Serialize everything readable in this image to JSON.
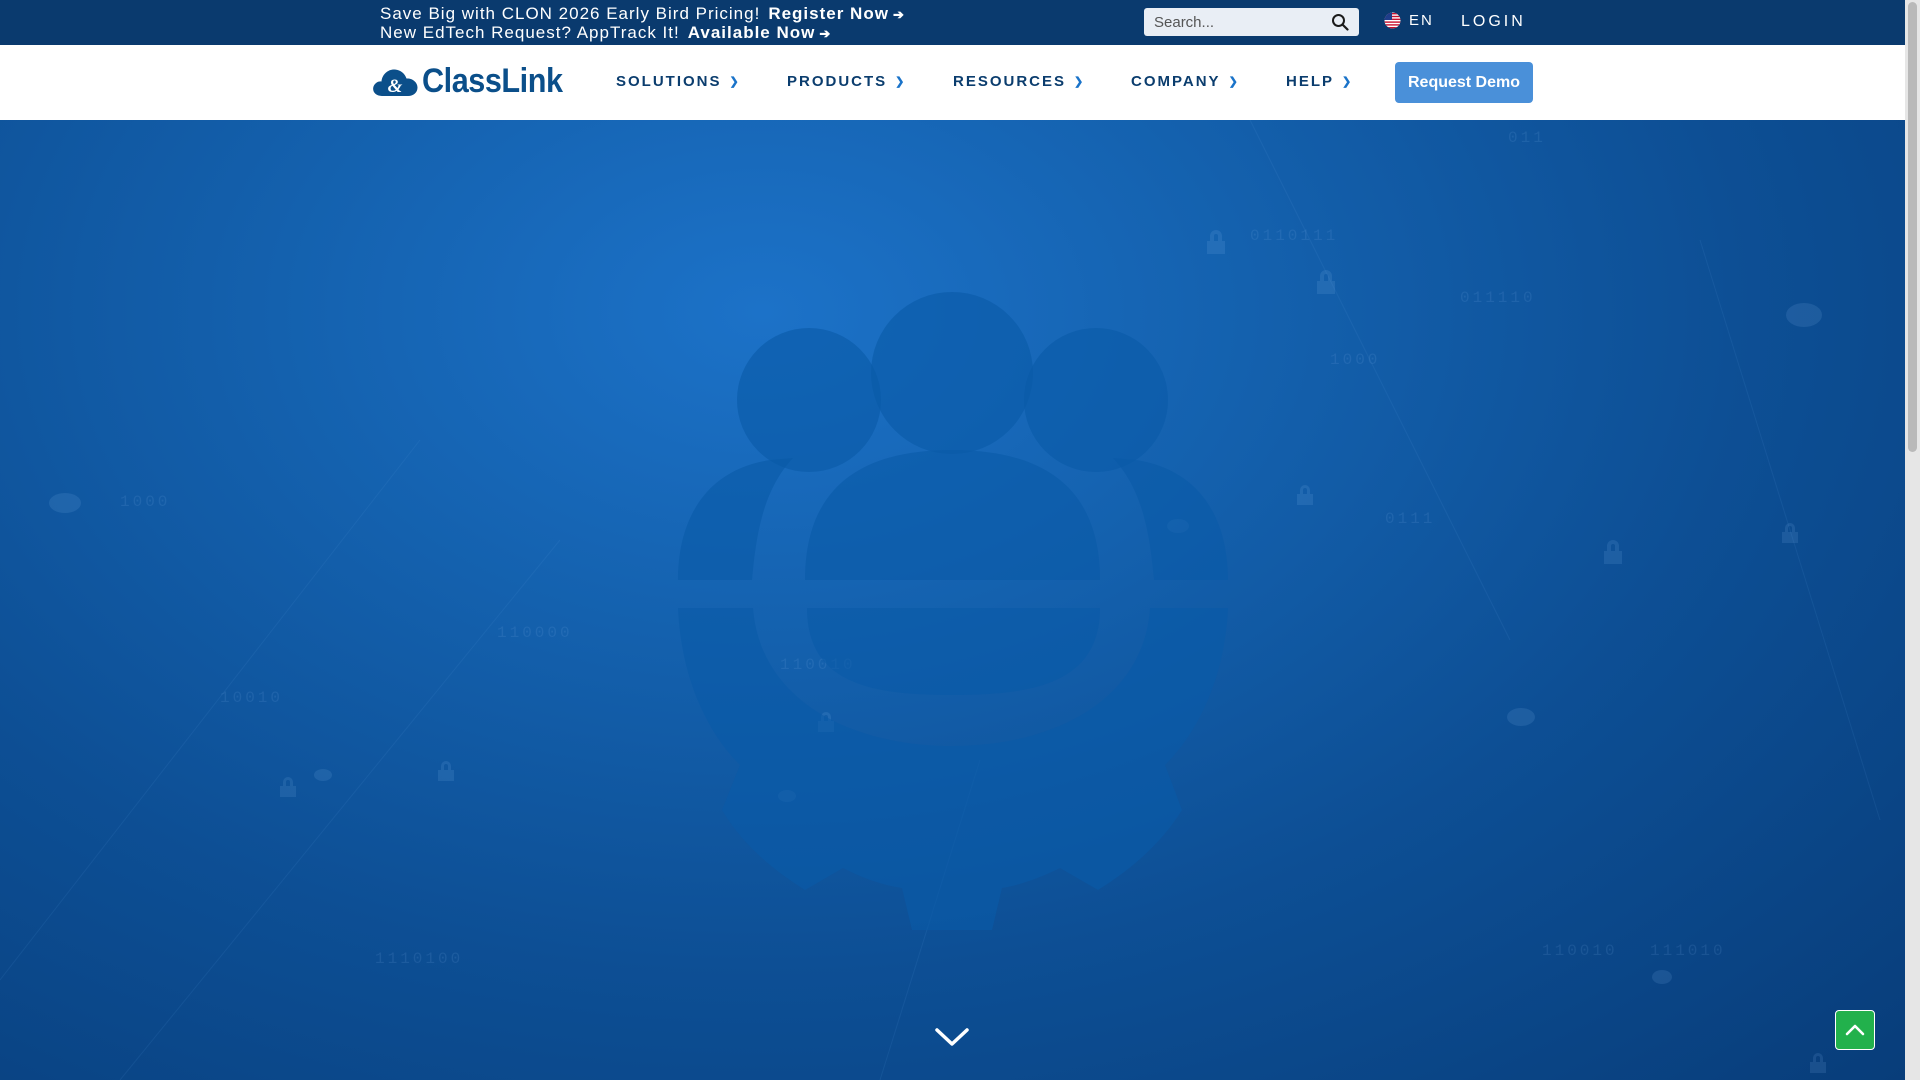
{
  "topbar": {
    "promo_text": "Save Big with CLON 2026 Early Bird Pricing!",
    "promo_link": "Register Now",
    "apptrack_text": "New EdTech Request? AppTrack It!",
    "apptrack_link": "Available Now",
    "search_placeholder": "Search...",
    "language": "EN",
    "login": "LOGIN"
  },
  "nav": {
    "logo": "ClassLink",
    "menu": [
      "SOLUTIONS",
      "PRODUCTS",
      "RESOURCES",
      "COMPANY",
      "HELP"
    ],
    "cta": "Request Demo"
  },
  "hero": {
    "binary_labels": [
      "1000",
      "0111",
      "110000",
      "1110100",
      "110010",
      "011110",
      "110010",
      "10010",
      "111010",
      "0110111",
      "011",
      "1000"
    ]
  },
  "colors": {
    "topbar": "#0a3a6e",
    "nav_text": "#0b3d6e",
    "cta": "#4a90d9",
    "hero": "#0d4f96",
    "back_to_top": "#22b14c"
  }
}
